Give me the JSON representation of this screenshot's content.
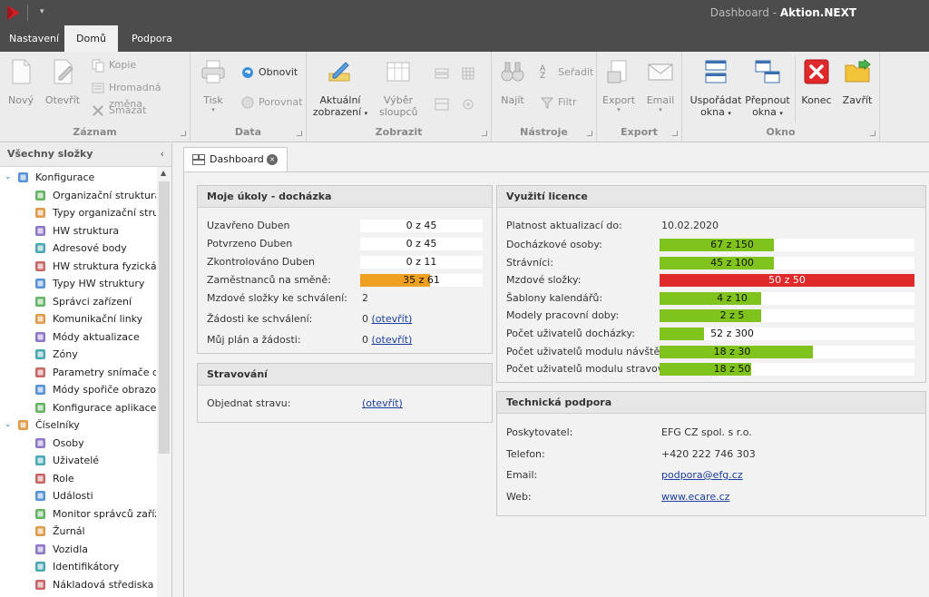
{
  "titlebar": {
    "title_prefix": "Dashboard - ",
    "app_name": "Aktion.NEXT"
  },
  "menu": {
    "tabs": [
      "Nastavení",
      "Domů",
      "Podpora"
    ]
  },
  "ribbon": {
    "zaznam": {
      "label": "Záznam",
      "new": "Nový",
      "open": "Otevřít",
      "copy": "Kopie",
      "bulk": "Hromadná změna",
      "delete": "Smazat"
    },
    "data": {
      "label": "Data",
      "print": "Tisk",
      "refresh": "Obnovit",
      "compare": "Porovnat"
    },
    "zobrazit": {
      "label": "Zobrazit",
      "current_view_1": "Aktuální",
      "current_view_2": "zobrazení",
      "cols_1": "Výběr",
      "cols_2": "sloupců"
    },
    "nastroje": {
      "label": "Nástroje",
      "find": "Najít",
      "sort": "Seřadit",
      "filter": "Filtr"
    },
    "export": {
      "label": "Export",
      "export": "Export",
      "email": "Email"
    },
    "okno": {
      "label": "Okno",
      "arrange_1": "Uspořádat",
      "arrange_2": "okna",
      "switch_1": "Přepnout",
      "switch_2": "okna",
      "end": "Konec",
      "close": "Zavřít"
    }
  },
  "sidebar": {
    "title": "Všechny složky",
    "items": [
      {
        "label": "Konfigurace",
        "level": 0,
        "icon": "network-icon"
      },
      {
        "label": "Organizační struktura",
        "level": 1,
        "icon": "org-chart-icon"
      },
      {
        "label": "Typy organizační stru...",
        "level": 1,
        "icon": "list-icon"
      },
      {
        "label": "HW struktura",
        "level": 1,
        "icon": "hardware-tree-icon"
      },
      {
        "label": "Adresové body",
        "level": 1,
        "icon": "address-icon"
      },
      {
        "label": "HW struktura fyzická",
        "level": 1,
        "icon": "hardware-physical-icon"
      },
      {
        "label": "Typy HW struktury",
        "level": 1,
        "icon": "list-icon"
      },
      {
        "label": "Správci zařízení",
        "level": 1,
        "icon": "device-manager-icon"
      },
      {
        "label": "Komunikační linky",
        "level": 1,
        "icon": "communication-icon"
      },
      {
        "label": "Módy aktualizace",
        "level": 1,
        "icon": "update-mode-icon"
      },
      {
        "label": "Zóny",
        "level": 1,
        "icon": "globe-icon"
      },
      {
        "label": "Parametry snímače o...",
        "level": 1,
        "icon": "sensor-icon"
      },
      {
        "label": "Módy spořiče obrazo...",
        "level": 1,
        "icon": "screensaver-icon"
      },
      {
        "label": "Konfigurace aplikace",
        "level": 1,
        "icon": "gear-icon"
      },
      {
        "label": "Číselníky",
        "level": 0,
        "icon": "books-icon"
      },
      {
        "label": "Osoby",
        "level": 1,
        "icon": "person-icon"
      },
      {
        "label": "Uživatelé",
        "level": 1,
        "icon": "user-icon"
      },
      {
        "label": "Role",
        "level": 1,
        "icon": "role-icon"
      },
      {
        "label": "Události",
        "level": 1,
        "icon": "events-icon"
      },
      {
        "label": "Monitor správců zaříz...",
        "level": 1,
        "icon": "monitor-icon"
      },
      {
        "label": "Žurnál",
        "level": 1,
        "icon": "journal-icon"
      },
      {
        "label": "Vozidla",
        "level": 1,
        "icon": "vehicle-icon"
      },
      {
        "label": "Identifikátory",
        "level": 1,
        "icon": "id-card-icon"
      },
      {
        "label": "Nákladová střediska",
        "level": 1,
        "icon": "cost-center-icon"
      }
    ]
  },
  "doc_tab": {
    "label": "Dashboard"
  },
  "tasks": {
    "title": "Moje úkoly - docházka",
    "rows": [
      {
        "label": "Uzavřeno Duben",
        "value": "0 z 45",
        "fraction": 0
      },
      {
        "label": "Potvrzeno Duben",
        "value": "0 z 45",
        "fraction": 0
      },
      {
        "label": "Zkontrolováno Duben",
        "value": "0 z 11",
        "fraction": 0
      },
      {
        "label": "Zaměstnanců na směně:",
        "value": "35 z 61",
        "fraction": 0.574
      }
    ],
    "salary_label": "Mzdové složky ke schválení:",
    "salary_value": "2",
    "requests_label": "Žádosti ke schválení:",
    "requests_count": "0",
    "requests_link": "(otevřít)",
    "plan_label": "Můj plán a žádosti:",
    "plan_count": "0",
    "plan_link": "(otevřít)"
  },
  "meals": {
    "title": "Stravování",
    "order_label": "Objednat stravu:",
    "order_link": "(otevřít)"
  },
  "license": {
    "title": "Využití licence",
    "valid_label": "Platnost aktualizací do:",
    "valid_value": "10.02.2020",
    "rows": [
      {
        "label": "Docházkové osoby:",
        "value": "67 z 150",
        "fraction": 0.447,
        "color": "#7fc31c"
      },
      {
        "label": "Strávníci:",
        "value": "45 z 100",
        "fraction": 0.45,
        "color": "#7fc31c"
      },
      {
        "label": "Mzdové složky:",
        "value": "50 z 50",
        "fraction": 1.0,
        "color": "#e0292b"
      },
      {
        "label": "Šablony kalendářů:",
        "value": "4 z 10",
        "fraction": 0.4,
        "color": "#7fc31c"
      },
      {
        "label": "Modely pracovní doby:",
        "value": "2 z 5",
        "fraction": 0.4,
        "color": "#7fc31c"
      },
      {
        "label": "Počet uživatelů docházky:",
        "value": "52 z 300",
        "fraction": 0.173,
        "color": "#7fc31c"
      },
      {
        "label": "Počet uživatelů modulu návštěv:",
        "value": "18 z 30",
        "fraction": 0.6,
        "color": "#7fc31c"
      },
      {
        "label": "Počet uživatelů modulu stravování:",
        "value": "18 z 50",
        "fraction": 0.36,
        "color": "#7fc31c"
      }
    ]
  },
  "support": {
    "title": "Technická podpora",
    "provider_label": "Poskytovatel:",
    "provider_value": "EFG CZ spol. s r.o.",
    "phone_label": "Telefon:",
    "phone_value": "+420 222 746 303",
    "email_label": "Email:",
    "email_value": "podpora@efg.cz",
    "web_label": "Web:",
    "web_value": "www.ecare.cz"
  },
  "colors": {
    "accent_orange": "#f0a020",
    "bar_green": "#7fc31c",
    "bar_red": "#e0292b",
    "link_blue": "#1a3f9c"
  }
}
